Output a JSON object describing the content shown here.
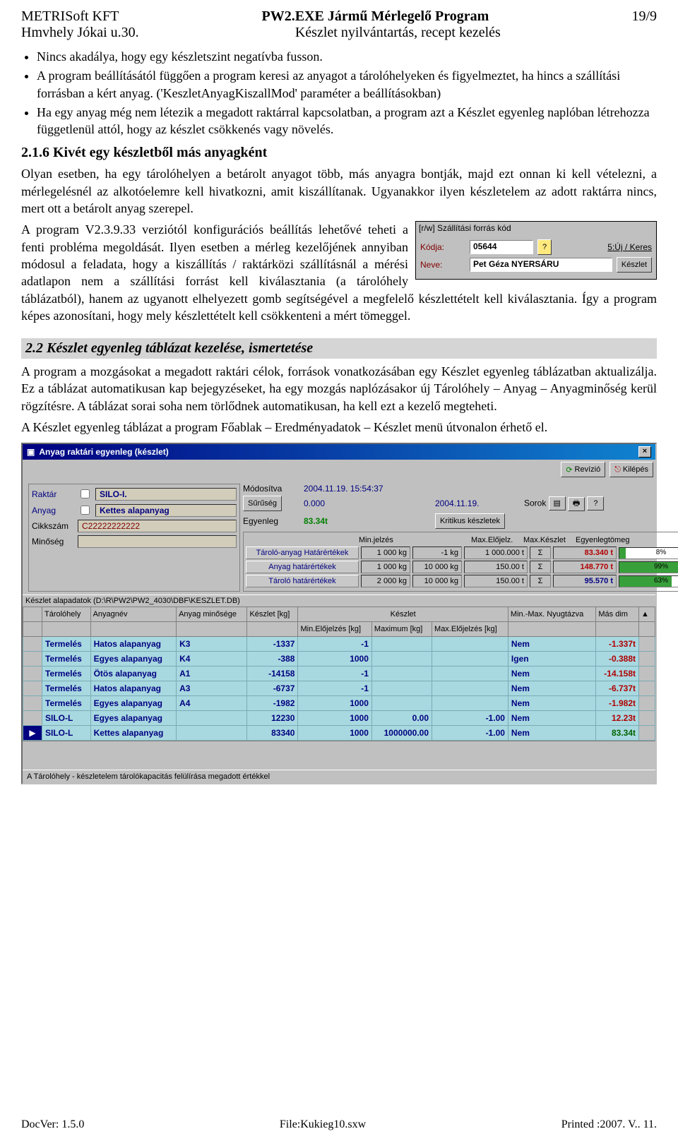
{
  "header": {
    "left": "METRISoft KFT",
    "center": "PW2.EXE Jármű Mérlegelő Program",
    "right": "19/9",
    "left2": "Hmvhely Jókai u.30.",
    "center2": "Készlet nyilvántartás, recept kezelés"
  },
  "bullets": [
    "Nincs akadálya, hogy egy készletszint negatívba fusson.",
    "A program beállításától függően a program keresi az anyagot a tárolóhelyeken és figyelmeztet, ha hincs a szállítási forrásban a kért anyag. ('KeszletAnyagKiszallMod' paraméter a beállításokban)",
    "Ha egy anyag még nem létezik a megadott raktárral kapcsolatban, a program azt a Készlet egyenleg naplóban létrehozza függetlenül attól, hogy az készlet csökkenés vagy növelés."
  ],
  "h216": "2.1.6 Kivét egy készletből más anyagként",
  "p216": "Olyan esetben, ha egy tárolóhelyen a betárolt anyagot több, más anyagra bontják, majd ezt onnan ki kell vételezni, a mérlegelésnél az alkotóelemre kell hivatkozni, amit kiszállítanak. Ugyanakkor ilyen készletelem az adott raktárra nincs, mert ott a betárolt anyag szerepel.",
  "pVer": "A program V2.3.9.33 verziótól konfigurációs beállítás lehetővé teheti a fenti probléma megoldását. Ilyen esetben a mérleg kezelőjének annyiban módosul a feladata, hogy a kiszállítás / raktárközi szállításnál a mérési adatlapon nem a szállítási forrást kell kiválasztania (a tárolóhely táblázatból), hanem az ugyanott elhelyezett gomb segítségével a megfelelő készlettételt kell kiválasztania. Így a program képes azonosítani, hogy mely készlettételt kell csökkenteni a mért tömeggel.",
  "shot1": {
    "title": "[r/w] Szállítási forrás kód",
    "kodja_lbl": "Kódja:",
    "kodja": "05644",
    "uj": "5:Új / Keres",
    "neve_lbl": "Neve:",
    "neve": "Pet Géza NYERSÁRU",
    "keszlet_btn": "Készlet"
  },
  "sect22": "2.2 Készlet egyenleg táblázat kezelése, ismertetése",
  "p22a": "A program a mozgásokat a megadott raktári célok, források vonatkozásában egy Készlet egyenleg táblázatban aktualizálja. Ez a táblázat automatikusan kap bejegyzéseket, ha egy mozgás naplózásakor új Tárolóhely – Anyag – Anyagminőség kerül rögzítésre. A táblázat sorai soha nem törlődnek automatikusan, ha kell ezt a kezelő megteheti.",
  "p22b": "A Készlet egyenleg táblázat a program Főablak – Eredményadatok – Készlet menü útvonalon érhető el.",
  "app": {
    "title": "Anyag raktári egyenleg (készlet)",
    "btn_rev": "Revízió",
    "btn_exit": "Kilépés",
    "sorok": "Sorok",
    "left": {
      "raktar_lbl": "Raktár",
      "raktar": "SILO-I.",
      "anyag_lbl": "Anyag",
      "anyag": "Kettes alapanyag",
      "cikk_lbl": "Cikkszám",
      "cikk": "C22222222222",
      "minoseg_lbl": "Minőség"
    },
    "kv": {
      "mod_lbl": "Módosítva",
      "mod": "2004.11.19. 15:54:37",
      "sur_lbl": "Sűrűség",
      "sur": "0.000",
      "date": "2004.11.19.",
      "egy_lbl": "Egyenleg",
      "egy": "83.34t",
      "krit": "Kritikus készletek"
    },
    "stat_head": {
      "c1": "Min.jelzés",
      "c2": "Max.Előjelz.",
      "c3": "Max.Készlet",
      "c4": "Egyenlegtömeg"
    },
    "stat": [
      {
        "lab": "Tároló-anyag Határértékek",
        "a": "1 000 kg",
        "b": "-1 kg",
        "c": "1 000.000 t",
        "s": "Σ",
        "d": "83.340 t",
        "pct": "8%",
        "pctw": 8,
        "cls": "green",
        "dcls": "dred"
      },
      {
        "lab": "Anyag határértékek",
        "a": "1 000 kg",
        "b": "10 000 kg",
        "c": "150.00 t",
        "s": "Σ",
        "d": "148.770 t",
        "pct": "99%",
        "pctw": 99,
        "cls": "red",
        "dcls": "dred"
      },
      {
        "lab": "Tároló határértékek",
        "a": "2 000 kg",
        "b": "10 000 kg",
        "c": "150.00 t",
        "s": "Σ",
        "d": "95.570 t",
        "pct": "63%",
        "pctw": 63,
        "cls": "green",
        "dcls": "navy"
      }
    ],
    "path": "Készlet alapadatok (D:\\R\\PW2\\PW2_4030\\DBF\\KESZLET.DB)",
    "cols": [
      "Tárolóhely",
      "Anyagnév",
      "Anyag\nminősége",
      "Készlet [kg]",
      "Min.Előjelzés\n[kg]",
      "Maximum\n[kg]",
      "Max.Előjelzés\n[kg]",
      "Min.-Max.\nNyugtázva",
      "Más dim"
    ],
    "ktitle": "Készlet",
    "rows": [
      {
        "t": "Termelés",
        "a": "Hatos alapanyag",
        "m": "K3",
        "k": "-1337",
        "mn": "-1",
        "mx": "",
        "me": "",
        "ny": "Nem",
        "d": "-1.337t",
        "dc": "dred"
      },
      {
        "t": "Termelés",
        "a": "Egyes alapanyag",
        "m": "K4",
        "k": "-388",
        "mn": "1000",
        "mx": "",
        "me": "",
        "ny": "Igen",
        "d": "-0.388t",
        "dc": "dred"
      },
      {
        "t": "Termelés",
        "a": "Ötös alapanyag",
        "m": "A1",
        "k": "-14158",
        "mn": "-1",
        "mx": "",
        "me": "",
        "ny": "Nem",
        "d": "-14.158t",
        "dc": "dred"
      },
      {
        "t": "Termelés",
        "a": "Hatos alapanyag",
        "m": "A3",
        "k": "-6737",
        "mn": "-1",
        "mx": "",
        "me": "",
        "ny": "Nem",
        "d": "-6.737t",
        "dc": "dred"
      },
      {
        "t": "Termelés",
        "a": "Egyes alapanyag",
        "m": "A4",
        "k": "-1982",
        "mn": "1000",
        "mx": "",
        "me": "",
        "ny": "Nem",
        "d": "-1.982t",
        "dc": "dred"
      },
      {
        "t": "SILO-L",
        "a": "Egyes alapanyag",
        "m": "",
        "k": "12230",
        "mn": "1000",
        "mx": "0.00",
        "me": "-1.00",
        "ny": "Nem",
        "d": "12.23t",
        "dc": "dred"
      },
      {
        "t": "SILO-L",
        "a": "Kettes alapanyag",
        "m": "",
        "k": "83340",
        "mn": "1000",
        "mx": "1000000.00",
        "me": "-1.00",
        "ny": "Nem",
        "d": "83.34t",
        "dc": "dgreen",
        "sel": true
      }
    ],
    "status": "A Tárolóhely - készletelem tárolókapacitás felülírása megadott értékkel"
  },
  "footer": {
    "l": "DocVer: 1.5.0",
    "c": "File:Kukieg10.sxw",
    "r": "Printed :2007. V.. 11."
  }
}
